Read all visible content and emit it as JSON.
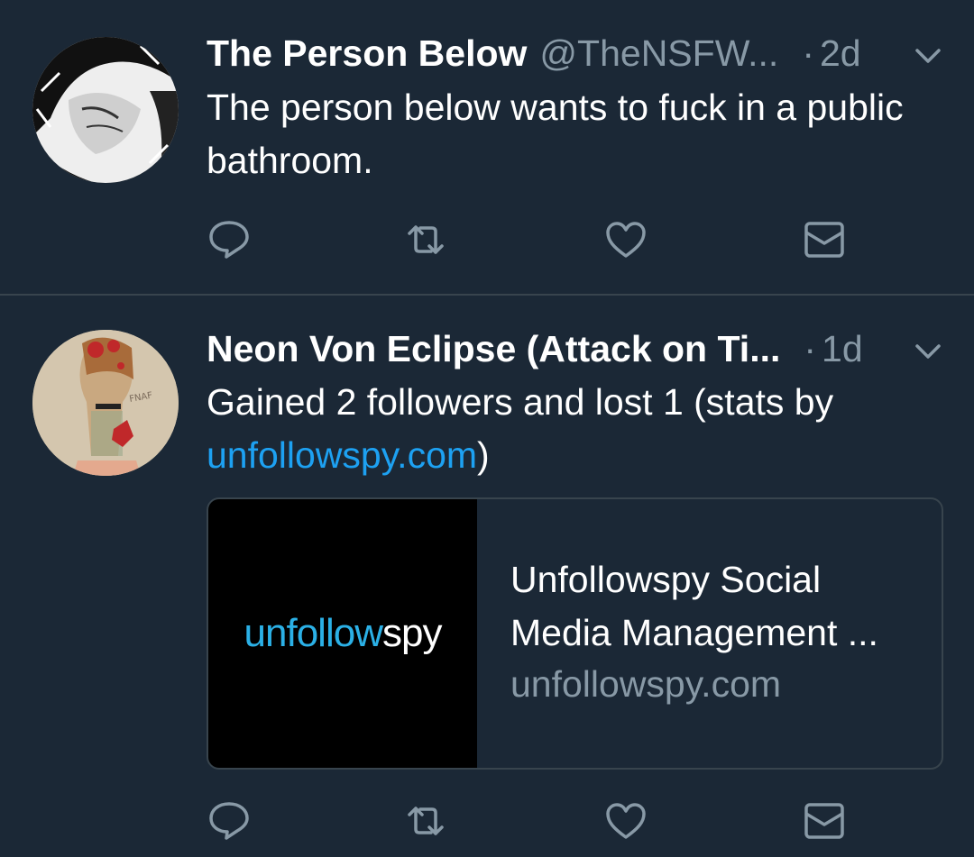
{
  "tweets": [
    {
      "name": "The Person Below",
      "handle": "@TheNSFW...",
      "time": "2d",
      "text": "The person below wants to fuck in a public bathroom."
    },
    {
      "name": "Neon Von Eclipse (Attack on Ti...",
      "time": "1d",
      "text_before_link": "Gained 2 followers and lost 1 (stats by ",
      "link": "unfollowspy.com",
      "text_after_link": ")",
      "card": {
        "logo_colored": "unfollow",
        "logo_white": "spy",
        "title": "Unfollowspy Social Media Management ...",
        "domain": "unfollowspy.com"
      }
    }
  ],
  "dot_separator": "·",
  "icons": [
    "reply-icon",
    "retweet-icon",
    "like-icon",
    "direct-message-icon",
    "chevron-down-icon"
  ],
  "colors": {
    "background": "#1b2836",
    "secondary_text": "#8899a6",
    "link": "#1da1f2",
    "divider": "#38444d"
  }
}
